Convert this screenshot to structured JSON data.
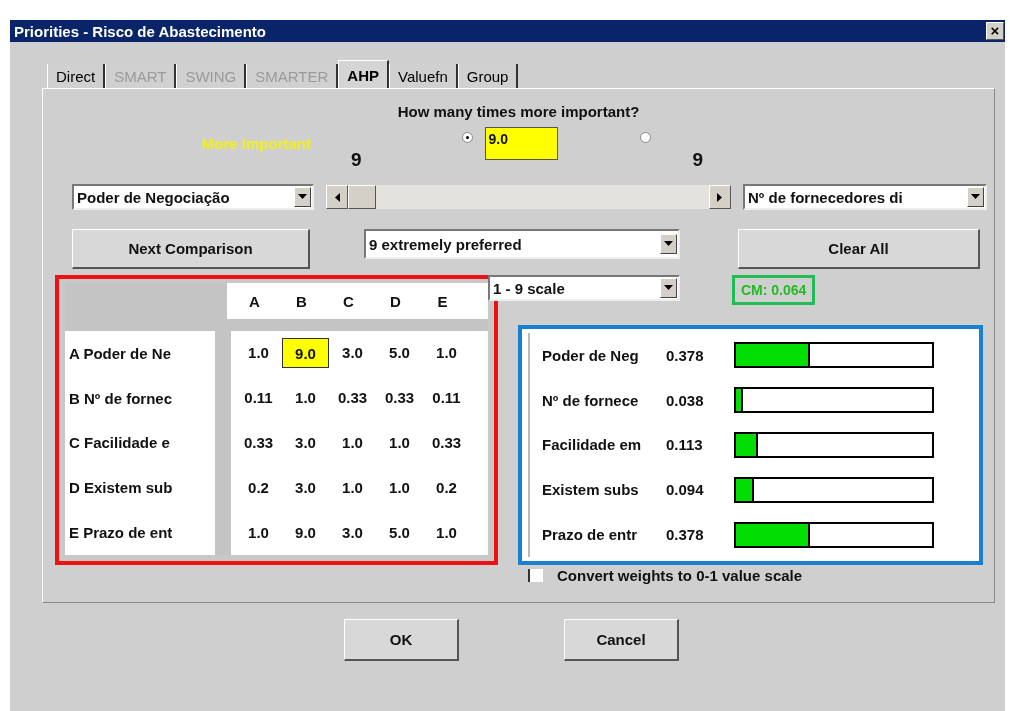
{
  "window": {
    "title": "Priorities - Risco de Abastecimento",
    "close": "×"
  },
  "tabs": [
    {
      "label": "Direct",
      "selected": false,
      "disabled": false
    },
    {
      "label": "SMART",
      "selected": false,
      "disabled": true
    },
    {
      "label": "SWING",
      "selected": false,
      "disabled": true
    },
    {
      "label": "SMARTER",
      "selected": false,
      "disabled": true
    },
    {
      "label": "AHP",
      "selected": true,
      "disabled": false
    },
    {
      "label": "Valuefn",
      "selected": false,
      "disabled": false
    },
    {
      "label": "Group",
      "selected": false,
      "disabled": false
    }
  ],
  "question": "How many times more important?",
  "more_important_label": "More Important",
  "left_radio": {
    "selected": true
  },
  "ratio_field": {
    "value": "9.0"
  },
  "right_radio": {
    "selected": false
  },
  "left_scale": "9",
  "right_scale": "9",
  "left_dropdown": "Poder de Negociação",
  "right_dropdown": "Nº de fornecedores di",
  "slider": {
    "level": 0
  },
  "next_button": "Next Comparison",
  "preference_dropdown": "9 extremely preferred",
  "clear_button": "Clear All",
  "scale_dropdown": "1 - 9 scale",
  "consistency": "CM: 0.064",
  "matrix": {
    "columns": [
      "A",
      "B",
      "C",
      "D",
      "E"
    ],
    "rows": [
      {
        "label": "A Poder de Ne",
        "cells": [
          {
            "value": "1.0",
            "selected": false
          },
          {
            "value": "9.0",
            "selected": true
          },
          {
            "value": "3.0",
            "selected": false
          },
          {
            "value": "5.0",
            "selected": false
          },
          {
            "value": "1.0",
            "selected": false
          }
        ]
      },
      {
        "label": "B Nº de fornec",
        "cells": [
          {
            "value": "0.11",
            "selected": false
          },
          {
            "value": "1.0",
            "selected": false
          },
          {
            "value": "0.33",
            "selected": false
          },
          {
            "value": "0.33",
            "selected": false
          },
          {
            "value": "0.11",
            "selected": false
          }
        ]
      },
      {
        "label": "C Facilidade e",
        "cells": [
          {
            "value": "0.33",
            "selected": false
          },
          {
            "value": "3.0",
            "selected": false
          },
          {
            "value": "1.0",
            "selected": false
          },
          {
            "value": "1.0",
            "selected": false
          },
          {
            "value": "0.33",
            "selected": false
          }
        ]
      },
      {
        "label": "D Existem sub",
        "cells": [
          {
            "value": "0.2",
            "selected": false
          },
          {
            "value": "3.0",
            "selected": false
          },
          {
            "value": "1.0",
            "selected": false
          },
          {
            "value": "1.0",
            "selected": false
          },
          {
            "value": "0.2",
            "selected": false
          }
        ]
      },
      {
        "label": "E Prazo de ent",
        "cells": [
          {
            "value": "1.0",
            "selected": false
          },
          {
            "value": "9.0",
            "selected": false
          },
          {
            "value": "3.0",
            "selected": false
          },
          {
            "value": "5.0",
            "selected": false
          },
          {
            "value": "1.0",
            "selected": false
          }
        ]
      }
    ]
  },
  "weights": [
    {
      "name": "Poder de Neg",
      "value": "0.378",
      "level": 0.378
    },
    {
      "name": "Nº de fornece",
      "value": "0.038",
      "level": 0.038
    },
    {
      "name": "Facilidade em",
      "value": "0.113",
      "level": 0.113
    },
    {
      "name": "Existem subs",
      "value": "0.094",
      "level": 0.094
    },
    {
      "name": "Prazo de entr",
      "value": "0.378",
      "level": 0.378
    }
  ],
  "convert_checkbox": {
    "label": "Convert weights to 0-1 value scale",
    "checked": false
  },
  "buttons": [
    "OK",
    "Cancel"
  ]
}
